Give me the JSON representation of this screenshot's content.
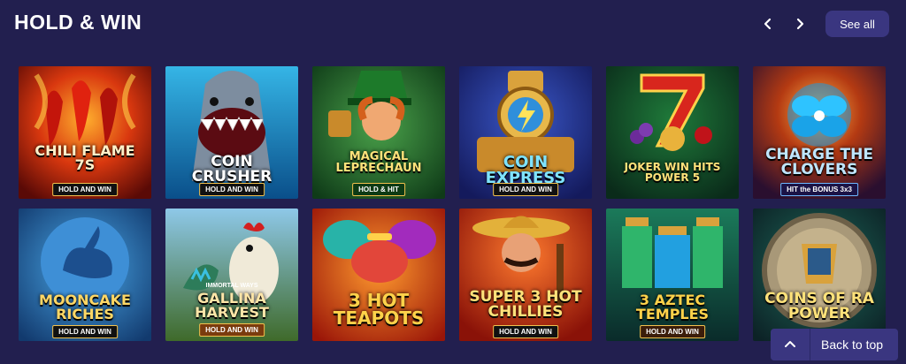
{
  "section": {
    "title": "HOLD & WIN"
  },
  "nav": {
    "prev_icon": "chevron-left-icon",
    "next_icon": "chevron-right-icon",
    "see_all_label": "See all"
  },
  "back_to_top": {
    "label": "Back to top",
    "icon": "chevron-up-icon"
  },
  "games": [
    {
      "title": "CHILI FLAME 7s",
      "subtitle": "HOLD AND WIN"
    },
    {
      "title": "COIN CRUSHER",
      "subtitle": "HOLD AND WIN"
    },
    {
      "title": "MAGICAL LEPRECHAUN",
      "subtitle": "HOLD & HIT"
    },
    {
      "title": "COIN EXPRESS",
      "subtitle": "HOLD AND WIN"
    },
    {
      "title": "JOKER WIN HITS POWER 5",
      "subtitle": ""
    },
    {
      "title": "CHARGE THE CLOVERS",
      "subtitle": "HIT the BONUS 3x3"
    },
    {
      "title": "MOONCAKE RICHES",
      "subtitle": "HOLD AND WIN"
    },
    {
      "title": "GALLINA HARVEST",
      "subtitle": "HOLD AND WIN",
      "pretitle": "IMMORTAL WAYS"
    },
    {
      "title": "3 HOT TEAPOTS",
      "subtitle": ""
    },
    {
      "title": "SUPER 3 HOT CHILLIES",
      "subtitle": "HOLD AND WIN"
    },
    {
      "title": "3 AZTEC TEMPLES",
      "subtitle": "HOLD AND WIN"
    },
    {
      "title": "COINS OF RA POWER",
      "subtitle": ""
    }
  ]
}
